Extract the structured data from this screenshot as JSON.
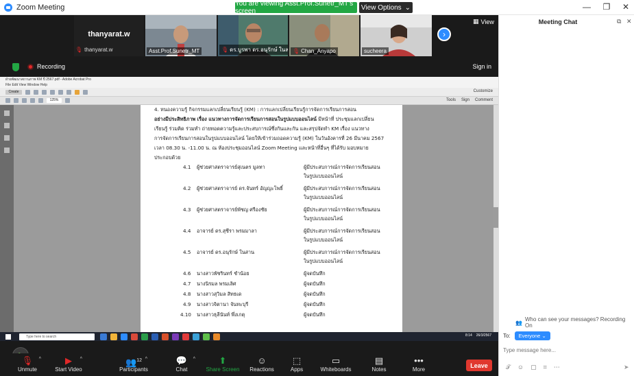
{
  "window": {
    "title": "Zoom Meeting",
    "viewing_banner": "You are viewing Asst.Prof.Sunetr_MT's screen",
    "view_options": "View Options",
    "minimize": "—",
    "restore": "❐",
    "close": "✕"
  },
  "strip": {
    "self_name_big": "thanyarat.w",
    "self_label": "thanyarat.w",
    "tiles": [
      {
        "label": "Asst.Prof.Sunetr_MT",
        "muted": false
      },
      {
        "label": "ดร.บูรพา ดร.อนุรักษ์ ในสาน",
        "muted": true
      },
      {
        "label": "Chan_Anyapo",
        "muted": true
      },
      {
        "label": "sucheera",
        "muted": false
      }
    ],
    "view_label": "View",
    "recording_label": "Recording",
    "signin_label": "Sign in"
  },
  "acrobat": {
    "title": "ฝ่ายพัฒนาสถานภาพ KM ปี 2567.pdf - Adobe Acrobat Pro",
    "menu": "File  Edit  View  Window  Help",
    "create": "Create",
    "customize": "Customize",
    "zoom": "125%",
    "tools": "Tools",
    "sign": "Sign",
    "comment": "Comment"
  },
  "document": {
    "heading_line": "4. หนองความรู้ กิจกรรมแลกเปลี่ยนเรียนรู้ (KM) : การแลกเปลี่ยนเรียนรู้การจัดการเรียนการสอน",
    "bold_line": "อย่างมีประสิทธิภาพ เรื่อง แนวทางการจัดการเรียนการสอนในรูปแบบออนไลน์",
    "body_line1_tail": "มีหน้าที่ ประชุมแลกเปลี่ยน",
    "body_line2": "เรียนรู้ ร่วมคิด ร่วมทำ ถ่ายทอดความรู้และประสบการณ์ซึ่งกันและกัน และสรุปจัดทำ KM เรื่อง แนวทาง",
    "body_line3": "การจัดการเรียนการสอนในรูปแบบออนไลน์ โดยให้เข้าร่วมถอดความรู้ (KM) ในวันอังคารที่ 26 มีนาคม 2567",
    "body_line4": "เวลา 08.30 น. -11.00 น. ณ ห้องประชุมออนไลน์ Zoom Meeting และหน้าที่อื่นๆ ที่ได้รับ มอบหมาย",
    "body_line5": "ประกอบด้วย",
    "members": [
      {
        "no": "4.1",
        "name": "ผู้ช่วยศาสตราจารย์สุเนตร มูลทา",
        "role1": "ผู้มีประสบการณ์การจัดการเรียนสอน",
        "role2": "ในรูปแบบออนไลน์"
      },
      {
        "no": "4.2",
        "name": "ผู้ช่วยศาสตราจารย์ ดร.จันทร์ อัญญะโพธิ์",
        "role1": "ผู้มีประสบการณ์การจัดการเรียนสอน",
        "role2": "ในรูปแบบออนไลน์"
      },
      {
        "no": "4.3",
        "name": "ผู้ช่วยศาสตราจารย์พัชญ ศรีองชัย",
        "role1": "ผู้มีประสบการณ์การจัดการเรียนสอน",
        "role2": "ในรูปแบบออนไลน์"
      },
      {
        "no": "4.4",
        "name": "อาจารย์ ดร.สุชีรา พรมมาลา",
        "role1": "ผู้มีประสบการณ์การจัดการเรียนสอน",
        "role2": "ในรูปแบบออนไลน์"
      },
      {
        "no": "4.5",
        "name": "อาจารย์ ดร.อนุรักษ์   ในสาน",
        "role1": "ผู้มีประสบการณ์การจัดการเรียนสอน",
        "role2": "ในรูปแบบออนไลน์"
      },
      {
        "no": "4.6",
        "name": "นางสาวพัชรินทร์  ชำน้อย",
        "role1": "ผู้จดบันทึก",
        "role2": ""
      },
      {
        "no": "4.7",
        "name": "นางนิรมล  พรมเลิศ",
        "role1": "ผู้จดบันทึก",
        "role2": ""
      },
      {
        "no": "4.8",
        "name": "นางสาวสุวิมล  สิทธเด",
        "role1": "ผู้จดบันทึก",
        "role2": ""
      },
      {
        "no": "4.9",
        "name": "นางสาวจิตานา  จันทะบุรี",
        "role1": "ผู้จดบันทึก",
        "role2": ""
      },
      {
        "no": "4.10",
        "name": "นางสาวธุลีนันท์  พึ่งเกตุ",
        "role1": "ผู้จดบันทึก",
        "role2": ""
      }
    ]
  },
  "taskbar": {
    "search_placeholder": "Type here to search",
    "time": "8:14",
    "date": "26/3/2567"
  },
  "toolbar": {
    "unmute": "Unmute",
    "start_video": "Start Video",
    "participants": "Participants",
    "participants_count": "12",
    "chat": "Chat",
    "share_screen": "Share Screen",
    "reactions": "Reactions",
    "apps": "Apps",
    "whiteboards": "Whiteboards",
    "notes": "Notes",
    "more": "More",
    "leave": "Leave"
  },
  "chat": {
    "title": "Meeting Chat",
    "who_can_see": "Who can see your messages? Recording On",
    "to_label": "To:",
    "recipient": "Everyone",
    "input_placeholder": "Type message here..."
  },
  "colors": {
    "zoom_blue": "#2d8cff",
    "green": "#23a744",
    "leave_red": "#e0382f",
    "dark_bg": "#1a1a1a"
  }
}
